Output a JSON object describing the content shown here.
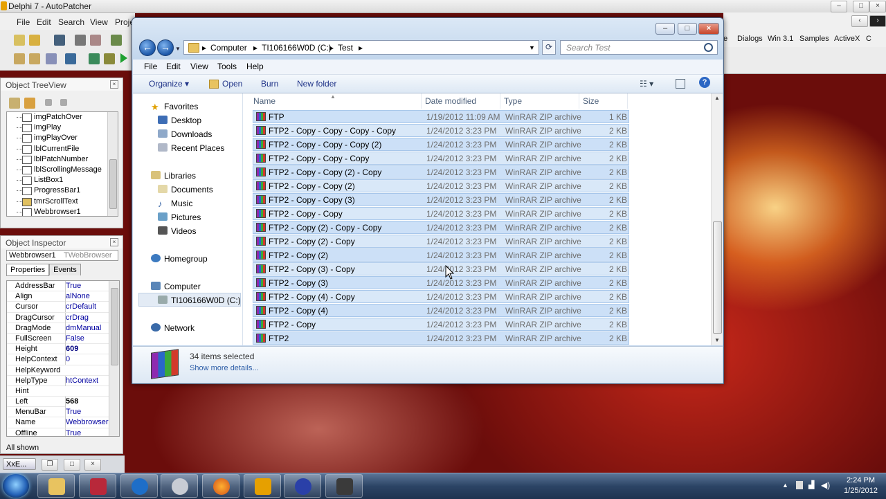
{
  "ide": {
    "title": "Delphi 7 - AutoPatcher",
    "menu": [
      "File",
      "Edit",
      "Search",
      "View",
      "Proje"
    ],
    "palette_tabs": [
      "e",
      "Dialogs",
      "Win 3.1",
      "Samples",
      "ActiveX",
      "C"
    ]
  },
  "object_treeview": {
    "title": "Object TreeView",
    "items": [
      "imgPatchOver",
      "imgPlay",
      "imgPlayOver",
      "lblCurrentFile",
      "lblPatchNumber",
      "lblScrollingMessage",
      "ListBox1",
      "ProgressBar1",
      "tmrScrollText",
      "Webbrowser1"
    ]
  },
  "object_inspector": {
    "title": "Object Inspector",
    "object_name": "Webbrowser1",
    "object_type": "TWebBrowser",
    "tabs": [
      "Properties",
      "Events"
    ],
    "properties": [
      {
        "name": "AddressBar",
        "value": "True"
      },
      {
        "name": "Align",
        "value": "alNone"
      },
      {
        "name": "Cursor",
        "value": "crDefault"
      },
      {
        "name": "DragCursor",
        "value": "crDrag"
      },
      {
        "name": "DragMode",
        "value": "dmManual"
      },
      {
        "name": "FullScreen",
        "value": "False"
      },
      {
        "name": "Height",
        "value": "609"
      },
      {
        "name": "HelpContext",
        "value": "0"
      },
      {
        "name": "HelpKeyword",
        "value": ""
      },
      {
        "name": "HelpType",
        "value": "htContext"
      },
      {
        "name": "Hint",
        "value": ""
      },
      {
        "name": "Left",
        "value": "568"
      },
      {
        "name": "MenuBar",
        "value": "True"
      },
      {
        "name": "Name",
        "value": "Webbrowser1"
      },
      {
        "name": "Offline",
        "value": "True"
      }
    ],
    "status": "All shown"
  },
  "mini_task": {
    "label": "XxE..."
  },
  "explorer": {
    "breadcrumb": [
      "Computer",
      "TI106166W0D (C:)",
      "Test"
    ],
    "search_placeholder": "Search Test",
    "menu": [
      "File",
      "Edit",
      "View",
      "Tools",
      "Help"
    ],
    "commands": [
      "Organize",
      "Open",
      "Burn",
      "New folder"
    ],
    "nav": {
      "favorites": "Favorites",
      "favorites_items": [
        "Desktop",
        "Downloads",
        "Recent Places"
      ],
      "libraries": "Libraries",
      "libraries_items": [
        "Documents",
        "Music",
        "Pictures",
        "Videos"
      ],
      "homegroup": "Homegroup",
      "computer": "Computer",
      "drive": "TI106166W0D (C:)",
      "network": "Network"
    },
    "columns": [
      "Name",
      "Date modified",
      "Type",
      "Size"
    ],
    "files": [
      {
        "name": "FTP",
        "date": "1/19/2012 11:09 AM",
        "type": "WinRAR ZIP archive",
        "size": "1 KB"
      },
      {
        "name": "FTP2 - Copy - Copy - Copy - Copy",
        "date": "1/24/2012 3:23 PM",
        "type": "WinRAR ZIP archive",
        "size": "2 KB"
      },
      {
        "name": "FTP2 - Copy - Copy - Copy (2)",
        "date": "1/24/2012 3:23 PM",
        "type": "WinRAR ZIP archive",
        "size": "2 KB"
      },
      {
        "name": "FTP2 - Copy - Copy - Copy",
        "date": "1/24/2012 3:23 PM",
        "type": "WinRAR ZIP archive",
        "size": "2 KB"
      },
      {
        "name": "FTP2 - Copy - Copy (2) - Copy",
        "date": "1/24/2012 3:23 PM",
        "type": "WinRAR ZIP archive",
        "size": "2 KB"
      },
      {
        "name": "FTP2 - Copy - Copy (2)",
        "date": "1/24/2012 3:23 PM",
        "type": "WinRAR ZIP archive",
        "size": "2 KB"
      },
      {
        "name": "FTP2 - Copy - Copy (3)",
        "date": "1/24/2012 3:23 PM",
        "type": "WinRAR ZIP archive",
        "size": "2 KB"
      },
      {
        "name": "FTP2 - Copy - Copy",
        "date": "1/24/2012 3:23 PM",
        "type": "WinRAR ZIP archive",
        "size": "2 KB"
      },
      {
        "name": "FTP2 - Copy (2) - Copy - Copy",
        "date": "1/24/2012 3:23 PM",
        "type": "WinRAR ZIP archive",
        "size": "2 KB"
      },
      {
        "name": "FTP2 - Copy (2) - Copy",
        "date": "1/24/2012 3:23 PM",
        "type": "WinRAR ZIP archive",
        "size": "2 KB"
      },
      {
        "name": "FTP2 - Copy (2)",
        "date": "1/24/2012 3:23 PM",
        "type": "WinRAR ZIP archive",
        "size": "2 KB"
      },
      {
        "name": "FTP2 - Copy (3) - Copy",
        "date": "1/24/2012 3:23 PM",
        "type": "WinRAR ZIP archive",
        "size": "2 KB"
      },
      {
        "name": "FTP2 - Copy (3)",
        "date": "1/24/2012 3:23 PM",
        "type": "WinRAR ZIP archive",
        "size": "2 KB"
      },
      {
        "name": "FTP2 - Copy (4) - Copy",
        "date": "1/24/2012 3:23 PM",
        "type": "WinRAR ZIP archive",
        "size": "2 KB"
      },
      {
        "name": "FTP2 - Copy (4)",
        "date": "1/24/2012 3:23 PM",
        "type": "WinRAR ZIP archive",
        "size": "2 KB"
      },
      {
        "name": "FTP2 - Copy",
        "date": "1/24/2012 3:23 PM",
        "type": "WinRAR ZIP archive",
        "size": "2 KB"
      },
      {
        "name": "FTP2",
        "date": "1/24/2012 3:23 PM",
        "type": "WinRAR ZIP archive",
        "size": "2 KB"
      }
    ],
    "selection_count": "34 items selected",
    "show_more": "Show more details..."
  },
  "taskbar": {
    "time": "2:24 PM",
    "date": "1/25/2012"
  },
  "colors": {
    "selection": "#cce0f7",
    "accent": "#1e3287"
  }
}
